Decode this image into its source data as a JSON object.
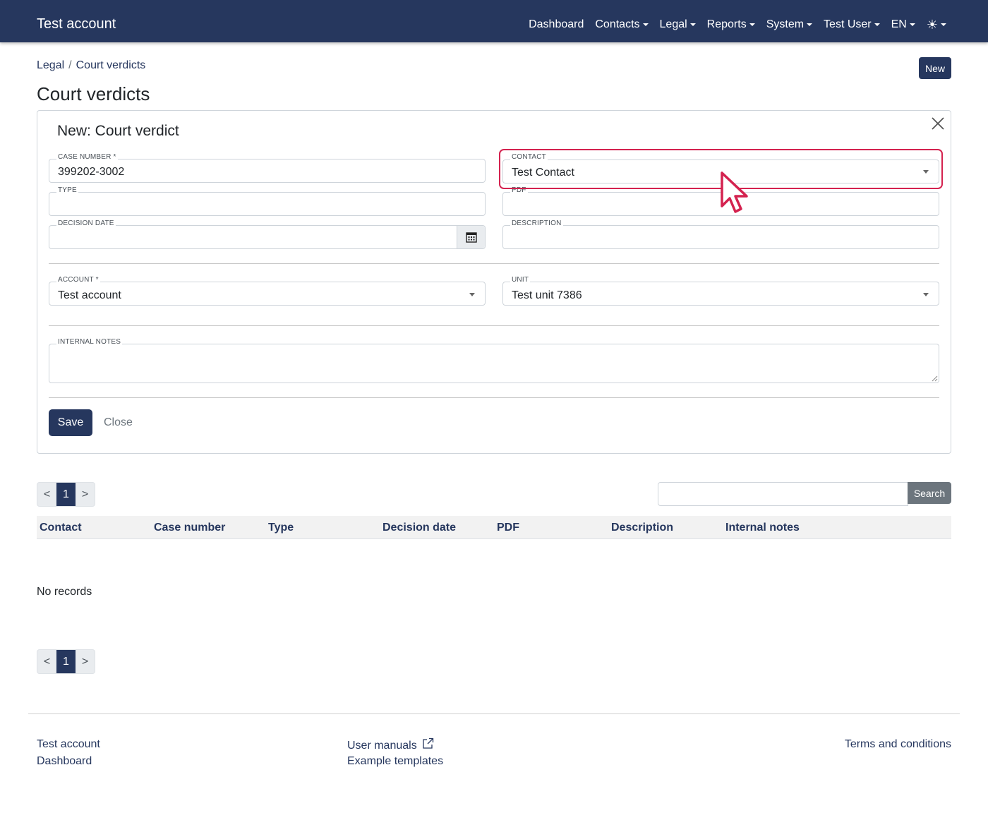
{
  "navbar": {
    "brand": "Test account",
    "items": [
      {
        "label": "Dashboard",
        "dropdown": false
      },
      {
        "label": "Contacts",
        "dropdown": true
      },
      {
        "label": "Legal",
        "dropdown": true
      },
      {
        "label": "Reports",
        "dropdown": true
      },
      {
        "label": "System",
        "dropdown": true
      },
      {
        "label": "Test User",
        "dropdown": true
      },
      {
        "label": "EN",
        "dropdown": true
      }
    ],
    "theme_icon": "sun-icon",
    "bg_color": "#26375e"
  },
  "breadcrumb": [
    "Legal",
    "Court verdicts"
  ],
  "new_button": "New",
  "page_title": "Court verdicts",
  "form": {
    "title": "New: Court verdict",
    "case_number": {
      "label": "CASE NUMBER *",
      "value": "399202-3002"
    },
    "contact": {
      "label": "CONTACT",
      "value": "Test Contact"
    },
    "type": {
      "label": "TYPE",
      "value": ""
    },
    "pdf": {
      "label": "PDF",
      "value": ""
    },
    "decision_date": {
      "label": "DECISION DATE",
      "value": ""
    },
    "description": {
      "label": "DESCRIPTION",
      "value": ""
    },
    "account": {
      "label": "ACCOUNT *",
      "value": "Test account"
    },
    "unit": {
      "label": "UNIT",
      "value": "Test unit 7386"
    },
    "internal_notes": {
      "label": "INTERNAL NOTES",
      "value": ""
    },
    "save_label": "Save",
    "close_label": "Close"
  },
  "pagination": {
    "prev": "<",
    "current": "1",
    "next": ">"
  },
  "search": {
    "button_label": "Search",
    "value": ""
  },
  "table": {
    "columns": [
      "Contact",
      "Case number",
      "Type",
      "Decision date",
      "PDF",
      "Description",
      "Internal notes"
    ],
    "empty_text": "No records"
  },
  "footer": {
    "col1": [
      "Test account",
      "Dashboard"
    ],
    "col2": [
      "User manuals",
      "Example templates"
    ],
    "col3": [
      "Terms and conditions"
    ]
  },
  "colors": {
    "primary": "#26375e",
    "highlight": "#d4224f",
    "secondary": "#6c757d"
  }
}
